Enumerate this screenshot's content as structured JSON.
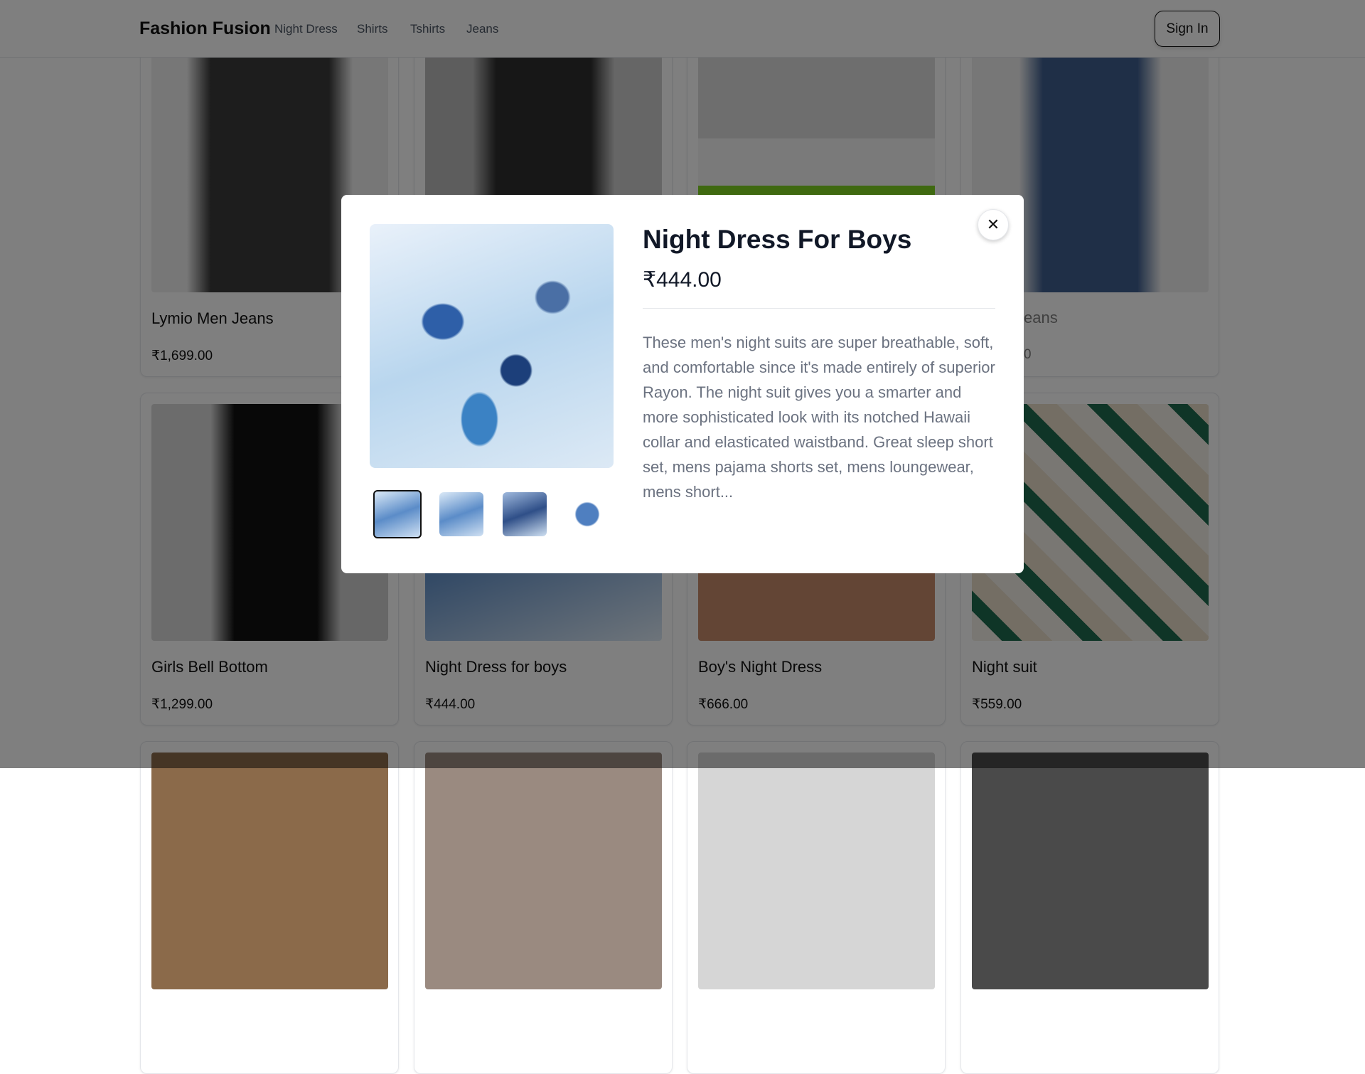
{
  "header": {
    "logo": "Fashion Fusion",
    "nav": [
      "Night Dress",
      "Shirts",
      "Tshirts",
      "Jeans"
    ],
    "sign_in": "Sign In"
  },
  "products": [
    {
      "title": "Lymio Men Jeans",
      "price": "₹1,699.00"
    },
    {
      "title": "",
      "price": ""
    },
    {
      "title": "",
      "price": ""
    },
    {
      "title": "",
      "price": ""
    },
    {
      "title": "Girls Bell Bottom",
      "price": "₹1,299.00"
    },
    {
      "title": "Night Dress for boys",
      "price": "₹444.00"
    },
    {
      "title": "Boy's Night Dress",
      "price": "₹666.00"
    },
    {
      "title": "Night suit",
      "price": "₹559.00"
    }
  ],
  "partial_visible": {
    "title": "eans",
    "price": "0"
  },
  "modal": {
    "title": "Night Dress For Boys",
    "price": "₹444.00",
    "description": "These men's night suits are super breathable, soft, and comfortable since it's made entirely of superior Rayon. The night suit gives you a smarter and more sophisticated look with its notched Hawaii collar and elasticated waistband. Great sleep short set, mens pajama shorts set, mens loungewear, mens short...",
    "close_icon": "close-icon",
    "thumbnail_count": 4,
    "selected_thumbnail": 1
  }
}
